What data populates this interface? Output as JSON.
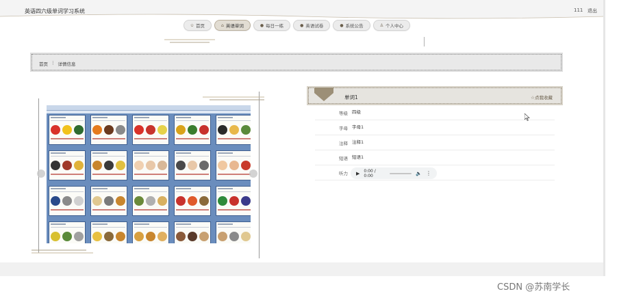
{
  "header": {
    "app_title": "英语四六级单词学习系统",
    "user": "111",
    "logout": "退出"
  },
  "nav": {
    "items": [
      {
        "label": "首页",
        "icon": "home-icon",
        "active": false
      },
      {
        "label": "英语单词",
        "icon": "book-icon",
        "active": true
      },
      {
        "label": "每日一练",
        "icon": "dot-icon",
        "active": false
      },
      {
        "label": "英语试卷",
        "icon": "dot-icon",
        "active": false
      },
      {
        "label": "系统公告",
        "icon": "dot-icon",
        "active": false
      },
      {
        "label": "个人中心",
        "icon": "user-icon",
        "active": false
      }
    ]
  },
  "breadcrumb": {
    "home": "首页",
    "separator": "⋮",
    "current": "详情信息"
  },
  "detail": {
    "word": "单词1",
    "favorite": "☆点我收藏",
    "fields": [
      {
        "label": "等级",
        "value": "四级"
      },
      {
        "label": "字母",
        "value": "字母1"
      },
      {
        "label": "注释",
        "value": "注释1"
      },
      {
        "label": "短语",
        "value": "短语1"
      }
    ],
    "audio_label": "听力",
    "audio_time": "0:00 / 0:00"
  },
  "colors": {
    "accent": "#8b7f6b",
    "nav_active": "#e2ddd3",
    "sheet_blue": "#6a8dbd"
  },
  "watermark": "CSDN @苏南学长"
}
